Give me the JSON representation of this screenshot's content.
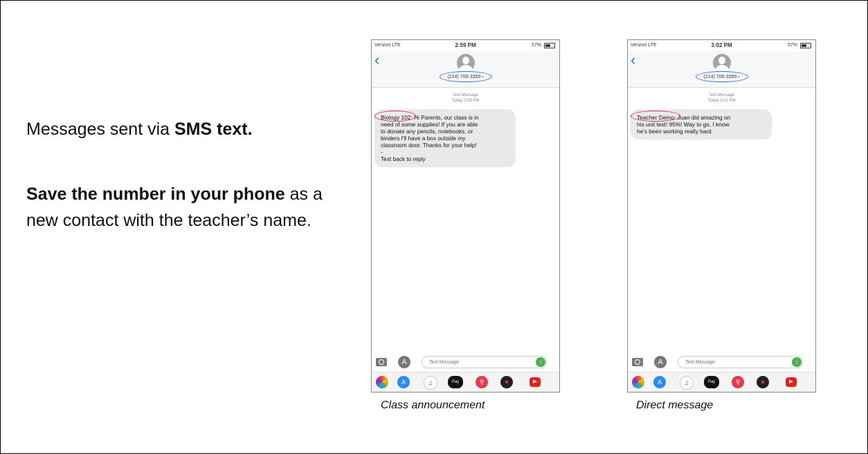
{
  "left_panel": {
    "line1_prefix": "Messages sent via ",
    "line1_bold": "SMS text.",
    "line2_bold": "Save the number in your phone",
    "line2_rest": " as a new contact with the teacher’s name."
  },
  "phones": [
    {
      "status": {
        "carrier": "Verizon  LTE",
        "time": "2:59 PM",
        "battery": "57%"
      },
      "contact_number": "(214) 705-3350 ›",
      "meta_line1": "Text Message",
      "meta_line2": "Today 2:59 PM",
      "bubble_lines": [
        "Biology 102: Hi Parents, our class is in",
        "need of some supplies! If you are able",
        "to donate any pencils, notebooks, or",
        "binders I'll have a box outside my",
        "classroom door. Thanks for your help!",
        "-",
        "Text back to reply"
      ],
      "compose_placeholder": "Text Message",
      "caption": "Class announcement"
    },
    {
      "status": {
        "carrier": "Verizon  LTE",
        "time": "3:02 PM",
        "battery": "57%"
      },
      "contact_number": "(214) 705-3350 ›",
      "meta_line1": "Text Message",
      "meta_line2": "Today 3:02 PM",
      "bubble_lines": [
        "Teacher Demo: Juan did amazing on",
        "his unit test! 95%! Way to go, I know",
        "he's been working really hard."
      ],
      "compose_placeholder": "Text Message",
      "caption": "Direct message"
    }
  ],
  "app_strip_icons": [
    "photos-icon",
    "app-store-icon",
    "music-icon",
    "apple-pay-icon",
    "search-icon",
    "heart-icon",
    "youtube-icon"
  ],
  "colors": {
    "ring_blue": "#2f6fd6",
    "ring_red": "#d93838",
    "bubble": "#e9e9eb",
    "ios_blue": "#1a73e8"
  }
}
